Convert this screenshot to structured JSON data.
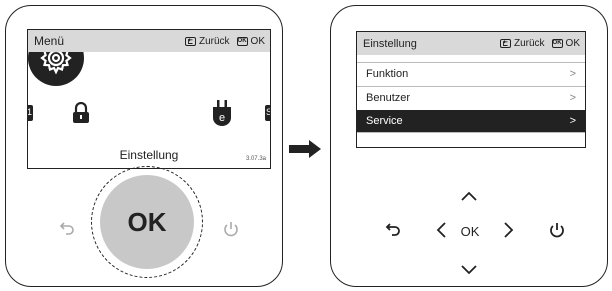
{
  "left_screen": {
    "title": "Menü",
    "back_label": "Zurück",
    "ok_label": "OK",
    "ok_icon_text": "OK",
    "selected_item": "Einstellung",
    "version": "3.07.3a",
    "edge_left_letter": "1",
    "edge_right_letter": "S",
    "icons": [
      "lock-icon",
      "gear-icon",
      "energy-plug-icon"
    ]
  },
  "left_controls": {
    "ok_button": "OK",
    "icons": [
      "back-icon",
      "power-icon"
    ]
  },
  "right_screen": {
    "title": "Einstellung",
    "back_label": "Zurück",
    "ok_label": "OK",
    "ok_icon_text": "OK",
    "items": [
      {
        "label": "Funktion",
        "selected": false
      },
      {
        "label": "Benutzer",
        "selected": false
      },
      {
        "label": "Service",
        "selected": true
      }
    ]
  },
  "right_controls": {
    "ok_label": "OK",
    "icons": [
      "back-icon",
      "arrow-up-icon",
      "arrow-down-icon",
      "arrow-left-icon",
      "arrow-right-icon",
      "power-icon"
    ]
  },
  "colors": {
    "screen_header": "#d9d9d9",
    "selected_row": "#222222",
    "ok_button": "#c8c8c8"
  }
}
